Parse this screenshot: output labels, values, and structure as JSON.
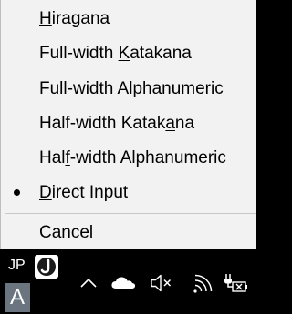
{
  "menu": {
    "items": [
      {
        "pre": "",
        "ul": "H",
        "post": "iragana",
        "checked": false
      },
      {
        "pre": "Full-width ",
        "ul": "K",
        "post": "atakana",
        "checked": false
      },
      {
        "pre": "Full-",
        "ul": "w",
        "post": "idth Alphanumeric",
        "checked": false
      },
      {
        "pre": "Half-width Katak",
        "ul": "a",
        "post": "na",
        "checked": false
      },
      {
        "pre": "Hal",
        "ul": "f",
        "post": "-width Alphanumeric",
        "checked": false
      },
      {
        "pre": "",
        "ul": "D",
        "post": "irect Input",
        "checked": true
      },
      {
        "pre": "Cancel",
        "ul": "",
        "post": "",
        "checked": false
      }
    ]
  },
  "taskbar": {
    "ime_language": "JP",
    "ime_mode": "A",
    "icons": [
      "ime-app-icon",
      "show-hidden-icons-chevron-icon",
      "onedrive-cloud-icon",
      "speaker-muted-icon",
      "wifi-icon",
      "battery-charging-icon"
    ]
  },
  "colors": {
    "menu_bg": "#f2f2f2",
    "taskbar_bg": "#000000",
    "ime_mode_bg": "#6a7580"
  }
}
